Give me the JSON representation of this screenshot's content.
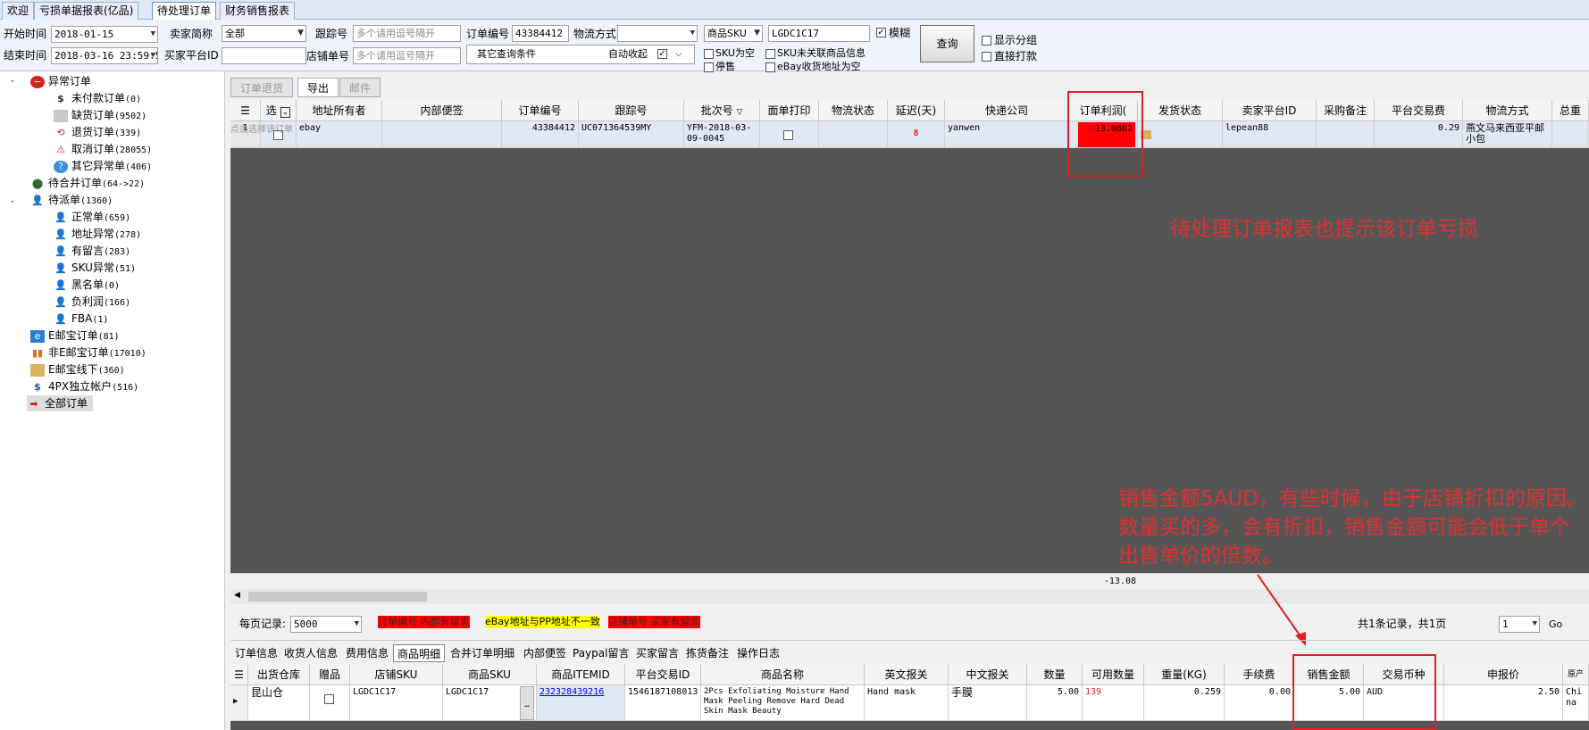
{
  "tabs": [
    "欢迎",
    "亏损单据报表(亿品)",
    "待处理订单",
    "财务销售报表"
  ],
  "filters": {
    "start_time_label": "开始时间",
    "start_time_value": "2018-01-15",
    "end_time_label": "结束时间",
    "end_time_value": "2018-03-16 23:59:5",
    "seller_label": "卖家简称",
    "seller_value": "全部",
    "platform_id_label": "买家平台ID",
    "tracking_label": "跟踪号",
    "tracking_placeholder": "多个请用逗号隔开",
    "shop_no_label": "店铺单号",
    "shop_no_placeholder": "多个请用逗号隔开",
    "order_no_label": "订单编号",
    "order_no_value": "43384412",
    "logistics_label": "物流方式",
    "other_conditions": "其它查询条件",
    "auto_collapse": "自动收起",
    "sku_select": "商品SKU",
    "sku_value": "LGDC1C17",
    "fuzzy": "模糊",
    "query_button": "查询",
    "sku_empty": "SKU为空",
    "sku_unlinked": "SKU未关联商品信息",
    "stop_sale": "停售",
    "ebay_addr_empty": "eBay收货地址为空",
    "show_group": "显示分组",
    "direct_print": "直接打款"
  },
  "tree": [
    {
      "label": "异常订单",
      "count": "",
      "icon": "stop-icon"
    },
    {
      "label": "未付款订单",
      "count": "(0)",
      "icon": "dollar-icon"
    },
    {
      "label": "缺货订单",
      "count": "(9502)",
      "icon": "box-icon"
    },
    {
      "label": "退货订单",
      "count": "(339)",
      "icon": "return-icon"
    },
    {
      "label": "取消订单",
      "count": "(28055)",
      "icon": "warning-icon"
    },
    {
      "label": "其它异常单",
      "count": "(406)",
      "icon": "question-icon"
    },
    {
      "label": "待合并订单",
      "count": "(64->22)",
      "icon": "merge-icon"
    },
    {
      "label": "待派单",
      "count": "(1360)",
      "icon": "user-icon"
    },
    {
      "label": "正常单",
      "count": "(659)",
      "icon": "user-icon"
    },
    {
      "label": "地址异常",
      "count": "(278)",
      "icon": "user-icon"
    },
    {
      "label": "有留言",
      "count": "(283)",
      "icon": "user-icon"
    },
    {
      "label": "SKU异常",
      "count": "(51)",
      "icon": "user-icon"
    },
    {
      "label": "黑名单",
      "count": "(0)",
      "icon": "user-icon"
    },
    {
      "label": "负利润",
      "count": "(166)",
      "icon": "user-icon"
    },
    {
      "label": "FBA",
      "count": "(1)",
      "icon": "user-icon"
    },
    {
      "label": "E邮宝订单",
      "count": "(81)",
      "icon": "ie-icon"
    },
    {
      "label": "非E邮宝订单",
      "count": "(17010)",
      "icon": "chart-icon"
    },
    {
      "label": "E邮宝线下",
      "count": "(360)",
      "icon": "box-icon"
    },
    {
      "label": "4PX独立帐户",
      "count": "(516)",
      "icon": "dollar-icon"
    },
    {
      "label": "全部订单",
      "count": "",
      "icon": "arrow-icon"
    }
  ],
  "subtabs": [
    "订单退货",
    "导出",
    "邮件"
  ],
  "grid": {
    "headers": [
      "选",
      "地址所有者",
      "内部便签",
      "订单编号",
      "跟踪号",
      "批次号",
      "面单打印",
      "物流状态",
      "延迟(天)",
      "快递公司",
      "订单利润(",
      "发货状态",
      "卖家平台ID",
      "采购备注",
      "平台交易费",
      "物流方式",
      "总重"
    ],
    "row": {
      "idx": "1",
      "owner": "ebay",
      "order_no": "43384412",
      "tracking": "UC071364539MY",
      "batch": "YFM-2018-03-09-0045",
      "delay": "8",
      "express": "yanwen",
      "profit": "-13.0802",
      "seller_id": "lepean88",
      "fee": "0.29",
      "shipping": "燕文马来西亚平邮小包"
    },
    "profit_total": "-13.08",
    "tooltip": "点击选择该订单"
  },
  "pager": {
    "per_page_label": "每页记录:",
    "per_page_value": "5000",
    "legend1": "订单编号 内部有留言",
    "legend2": "eBay地址与PP地址不一致",
    "legend3": "店铺单号 买家有留言",
    "summary": "共1条记录，共1页",
    "page": "1",
    "go": "Go"
  },
  "detail_tabs": [
    "订单信息",
    "收货人信息",
    "费用信息",
    "商品明细",
    "合并订单明细",
    "内部便签",
    "Paypal留言",
    "买家留言",
    "拣货备注",
    "操作日志"
  ],
  "detail": {
    "headers": [
      "出货仓库",
      "赠品",
      "店铺SKU",
      "商品SKU",
      "商品ITEMID",
      "平台交易ID",
      "商品名称",
      "英文报关",
      "中文报关",
      "数量",
      "可用数量",
      "重量(KG)",
      "手续费",
      "销售金额",
      "交易币种",
      "申报价",
      "原产"
    ],
    "row": {
      "warehouse": "昆山仓",
      "shop_sku": "LGDC1C17",
      "sku": "LGDC1C17",
      "item_id": "232328439216",
      "txn_id": "1546187108013",
      "name": "2Pcs Exfoliating Moisture Hand Mask Peeling Remove Hard Dead Skin Mask Beauty",
      "en_decl": "Hand mask",
      "cn_decl": "手膜",
      "qty": "5.00",
      "avail": "139",
      "weight": "0.259",
      "fee": "0.00",
      "amount": "5.00",
      "currency": "AUD",
      "declared": "2.50",
      "origin": "China"
    }
  },
  "annotations": {
    "note1": "待处理订单报表也提示该订单亏损",
    "note2": "销售金额5AUD，有些时候，由于店铺折扣的原因。数量买的多，会有折扣，销售金额可能会低于单个出售单价的倍数。"
  },
  "colors": {
    "annotation": "#e03030",
    "loss_cell": "#ff0000",
    "grid_bg": "#555555"
  }
}
